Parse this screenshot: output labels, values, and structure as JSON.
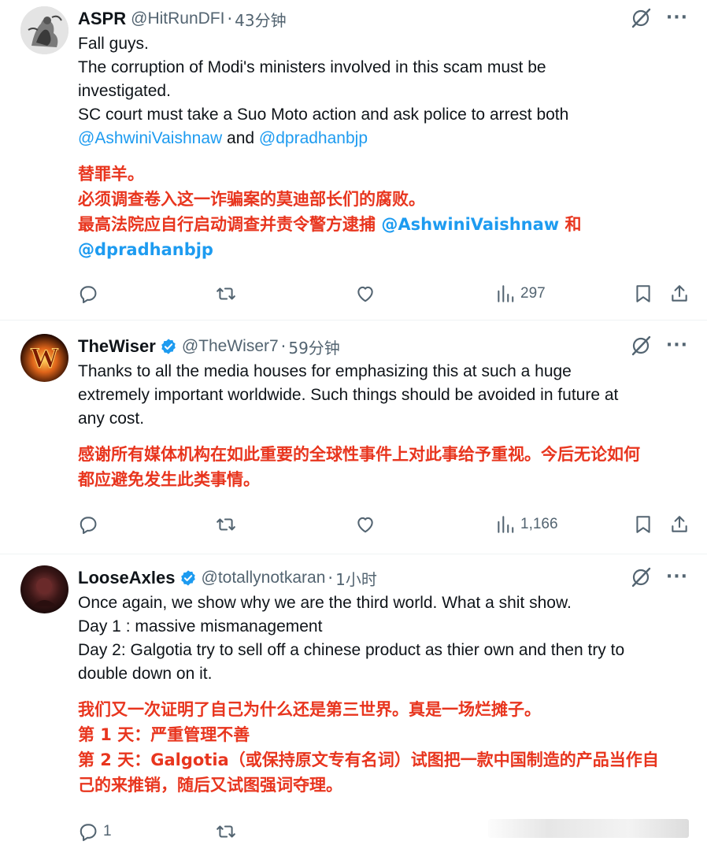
{
  "tweets": [
    {
      "name": "ASPR",
      "handle": "@HitRunDFI",
      "time": "43分钟",
      "verified": false,
      "en_lines": [
        [
          {
            "t": "Fall guys."
          }
        ],
        [
          {
            "t": "The corruption of Modi's ministers involved in this scam must be"
          }
        ],
        [
          {
            "t": "investigated."
          }
        ],
        [
          {
            "t": "SC court must take a Suo Moto action and ask police to arrest both"
          }
        ],
        [
          {
            "t": "@AshwiniVaishnaw",
            "m": true
          },
          {
            "t": " and "
          },
          {
            "t": "@dpradhanbjp",
            "m": true
          }
        ]
      ],
      "zh_lines": [
        [
          {
            "t": "替罪羊。"
          }
        ],
        [
          {
            "t": "必须调查卷入这一诈骗案的莫迪部长们的腐败。"
          }
        ],
        [
          {
            "t": "最高法院应自行启动调查并责令警方逮捕 "
          },
          {
            "t": "@AshwiniVaishnaw",
            "m": true
          },
          {
            "t": " 和"
          }
        ],
        [
          {
            "t": "@dpradhanbjp",
            "m": true
          }
        ]
      ],
      "views": "297",
      "replies": ""
    },
    {
      "name": "TheWiser",
      "handle": "@TheWiser7",
      "time": "59分钟",
      "verified": true,
      "en_lines": [
        [
          {
            "t": "Thanks to all the media houses for emphasizing this at such a huge"
          }
        ],
        [
          {
            "t": "extremely important worldwide. Such things should be avoided in future at"
          }
        ],
        [
          {
            "t": "any cost."
          }
        ]
      ],
      "zh_lines": [
        [
          {
            "t": "感谢所有媒体机构在如此重要的全球性事件上对此事给予重视。今后无论如何"
          }
        ],
        [
          {
            "t": "都应避免发生此类事情。"
          }
        ]
      ],
      "views": "1,166",
      "replies": ""
    },
    {
      "name": "LooseAxles",
      "handle": "@totallynotkaran",
      "time": "1小时",
      "verified": true,
      "en_lines": [
        [
          {
            "t": "Once again, we show why we are the third world. What a shit show."
          }
        ],
        [
          {
            "t": "Day 1 : massive mismanagement"
          }
        ],
        [
          {
            "t": "Day 2: Galgotia try to sell off a chinese product as thier own and then try to"
          }
        ],
        [
          {
            "t": "double down on it."
          }
        ]
      ],
      "zh_lines": [
        [
          {
            "t": "我们又一次证明了自己为什么还是第三世界。真是一场烂摊子。"
          }
        ],
        [
          {
            "t": "第 1 天：严重管理不善"
          }
        ],
        [
          {
            "t": "第 2 天：Galgotia（或保持原文专有名词）试图把一款中国制造的产品当作自"
          }
        ],
        [
          {
            "t": "己的来推销，随后又试图强词夺理。"
          }
        ]
      ],
      "views": "",
      "replies": "1"
    }
  ],
  "colors": {
    "mention": "#1d9bf0",
    "translation": "#e8351e",
    "secondary": "#536471",
    "verified": "#1d9bf0"
  },
  "icons": [
    "reply-icon",
    "retweet-icon",
    "like-icon",
    "views-icon",
    "bookmark-icon",
    "share-icon",
    "grok-icon",
    "more-icon",
    "verified-badge-icon"
  ]
}
